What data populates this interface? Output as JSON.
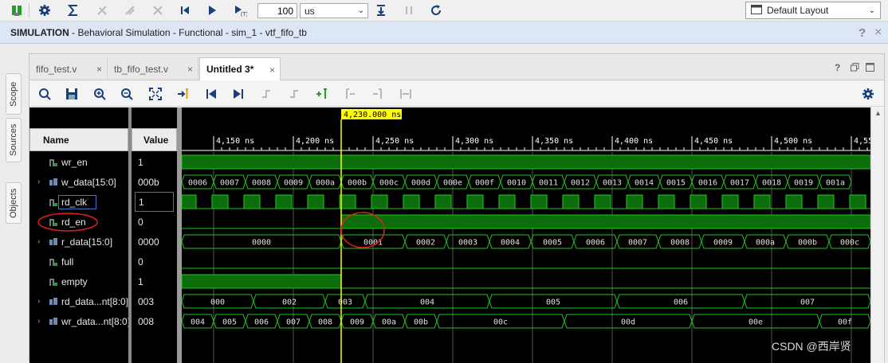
{
  "toolbar": {
    "run_length": "100",
    "run_unit": "us",
    "layout": "Default Layout",
    "buttons": [
      "settings-icon",
      "sigma-icon",
      "restart-icon",
      "run-all-icon",
      "break-icon",
      "go-start-icon",
      "run-icon",
      "run-for-icon"
    ]
  },
  "simbar": {
    "title": "SIMULATION",
    "subtitle": " - Behavioral Simulation - Functional - sim_1 - vtf_fifo_tb",
    "help": "?",
    "close": "×"
  },
  "sidetabs": [
    "Scope",
    "Sources",
    "Objects"
  ],
  "tabs": [
    {
      "label": "fifo_test.v",
      "active": false
    },
    {
      "label": "tb_fifo_test.v",
      "active": false
    },
    {
      "label": "Untitled 3*",
      "active": true
    }
  ],
  "panel_controls": {
    "help": "?"
  },
  "headers": {
    "name": "Name",
    "value": "Value"
  },
  "signals": [
    {
      "name": "wr_en",
      "value": "1",
      "type": "bit",
      "expandable": false
    },
    {
      "name": "w_data[15:0]",
      "value": "000b",
      "type": "bus",
      "expandable": true
    },
    {
      "name": "rd_clk",
      "value": "1",
      "type": "bit",
      "expandable": false,
      "selected": true
    },
    {
      "name": "rd_en",
      "value": "0",
      "type": "bit",
      "expandable": false
    },
    {
      "name": "r_data[15:0]",
      "value": "0000",
      "type": "bus",
      "expandable": true
    },
    {
      "name": "full",
      "value": "0",
      "type": "bit",
      "expandable": false
    },
    {
      "name": "empty",
      "value": "1",
      "type": "bit",
      "expandable": false
    },
    {
      "name": "rd_data...nt[8:0]",
      "value": "003",
      "type": "bus",
      "expandable": true
    },
    {
      "name": "wr_data...nt[8:0]",
      "value": "008",
      "type": "bus",
      "expandable": true
    }
  ],
  "cursor": {
    "label": "4,230.000 ns",
    "time": 4230
  },
  "timeline": {
    "ticks": [
      {
        "label": "4,150 ns",
        "t": 4150
      },
      {
        "label": "4,200 ns",
        "t": 4200
      },
      {
        "label": "4,250 ns",
        "t": 4250
      },
      {
        "label": "4,300 ns",
        "t": 4300
      },
      {
        "label": "4,350 ns",
        "t": 4350
      },
      {
        "label": "4,400 ns",
        "t": 4400
      },
      {
        "label": "4,450 ns",
        "t": 4450
      },
      {
        "label": "4,500 ns",
        "t": 4500
      },
      {
        "label": "4,55",
        "t": 4550
      }
    ]
  },
  "waves": {
    "w_data": [
      "0006",
      "0007",
      "0008",
      "0009",
      "000a",
      "000b",
      "000c",
      "000d",
      "000e",
      "000f",
      "0010",
      "0011",
      "0012",
      "0013",
      "0014",
      "0015",
      "0016",
      "0017",
      "0018",
      "0019",
      "001a"
    ],
    "r_data": [
      {
        "v": "0000",
        "t0": 4130,
        "t1": 4230
      },
      {
        "v": "0001",
        "t0": 4230,
        "t1": 4270
      },
      {
        "v": "0002",
        "t0": 4270,
        "t1": 4296
      },
      {
        "v": "0003",
        "t0": 4296,
        "t1": 4323
      },
      {
        "v": "0004",
        "t0": 4323,
        "t1": 4349
      },
      {
        "v": "0005",
        "t0": 4349,
        "t1": 4376
      },
      {
        "v": "0006",
        "t0": 4376,
        "t1": 4403
      },
      {
        "v": "0007",
        "t0": 4403,
        "t1": 4429
      },
      {
        "v": "0008",
        "t0": 4429,
        "t1": 4456
      },
      {
        "v": "0009",
        "t0": 4456,
        "t1": 4483
      },
      {
        "v": "000a",
        "t0": 4483,
        "t1": 4509
      },
      {
        "v": "000b",
        "t0": 4509,
        "t1": 4536
      },
      {
        "v": "000c",
        "t0": 4536,
        "t1": 4562
      }
    ],
    "rd_count": [
      {
        "v": "000",
        "t0": 4130,
        "t1": 4175
      },
      {
        "v": "002",
        "t0": 4175,
        "t1": 4220
      },
      {
        "v": "003",
        "t0": 4220,
        "t1": 4245
      },
      {
        "v": "004",
        "t0": 4245,
        "t1": 4323
      },
      {
        "v": "005",
        "t0": 4323,
        "t1": 4403
      },
      {
        "v": "006",
        "t0": 4403,
        "t1": 4483
      },
      {
        "v": "007",
        "t0": 4483,
        "t1": 4562
      }
    ],
    "wr_count": [
      {
        "v": "004",
        "t0": 4130,
        "t1": 4150
      },
      {
        "v": "005",
        "t0": 4150,
        "t1": 4170
      },
      {
        "v": "006",
        "t0": 4170,
        "t1": 4190
      },
      {
        "v": "007",
        "t0": 4190,
        "t1": 4210
      },
      {
        "v": "008",
        "t0": 4210,
        "t1": 4230
      },
      {
        "v": "009",
        "t0": 4230,
        "t1": 4250
      },
      {
        "v": "00a",
        "t0": 4250,
        "t1": 4270
      },
      {
        "v": "00b",
        "t0": 4270,
        "t1": 4290
      },
      {
        "v": "00c",
        "t0": 4290,
        "t1": 4370
      },
      {
        "v": "00d",
        "t0": 4370,
        "t1": 4450
      },
      {
        "v": "00e",
        "t0": 4450,
        "t1": 4530
      },
      {
        "v": "00f",
        "t0": 4530,
        "t1": 4562
      }
    ]
  },
  "watermark": "CSDN @西岸贤",
  "colors": {
    "wave": "#1ec81e",
    "wavefill": "#0b6e0b",
    "cursor": "#ffff00",
    "annot": "#e02020"
  }
}
